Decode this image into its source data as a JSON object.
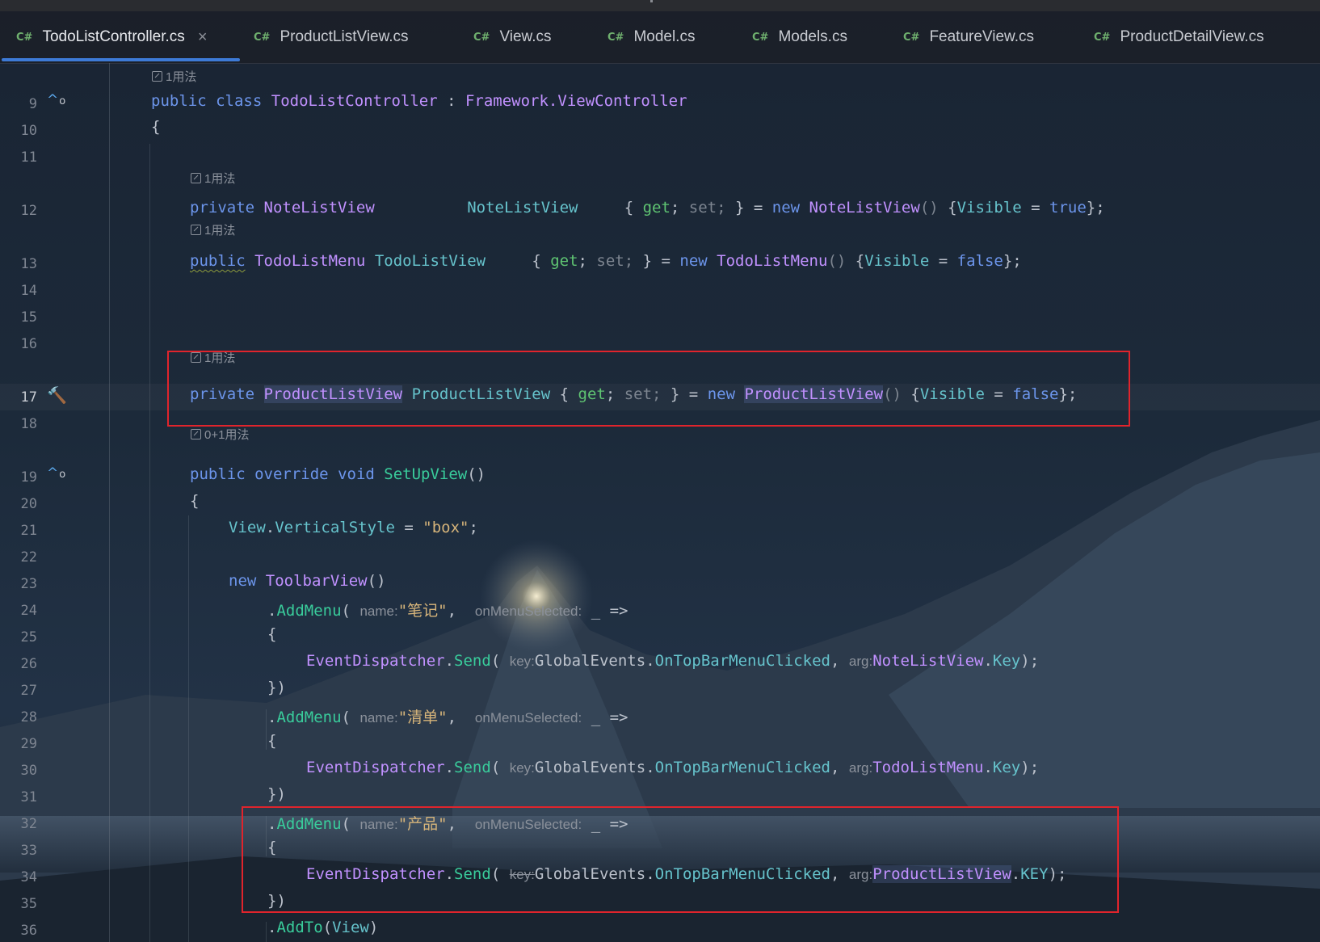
{
  "tabs": [
    {
      "icon": "C#",
      "label": "TodoListController.cs",
      "active": true,
      "close": "×"
    },
    {
      "icon": "C#",
      "label": "ProductListView.cs"
    },
    {
      "icon": "C#",
      "label": "View.cs"
    },
    {
      "icon": "C#",
      "label": "Model.cs"
    },
    {
      "icon": "C#",
      "label": "Models.cs"
    },
    {
      "icon": "C#",
      "label": "FeatureView.cs"
    },
    {
      "icon": "C#",
      "label": "ProductDetailView.cs"
    }
  ],
  "hints": {
    "usage1": "1用法",
    "usage01": "0+1用法"
  },
  "line_numbers": [
    "9",
    "10",
    "11",
    "12",
    "13",
    "14",
    "15",
    "16",
    "17",
    "18",
    "19",
    "20",
    "21",
    "22",
    "23",
    "24",
    "25",
    "26",
    "27",
    "28",
    "29",
    "30",
    "31",
    "32",
    "33",
    "34",
    "35",
    "36"
  ],
  "code": {
    "l9": {
      "kw1": "public",
      "kw2": "class",
      "name": "TodoListController",
      "colon": " : ",
      "base": "Framework.ViewController"
    },
    "l10": "{",
    "l12": {
      "mod": "private",
      "type": "NoteListView",
      "name": "NoteListView",
      "ob": "{ ",
      "get": "get",
      "semi1": ";",
      "set": " set;",
      "cb": " } = ",
      "new": "new",
      "ctor": "NoteListView",
      "paren": "()",
      "init_open": " {",
      "prop": "Visible",
      "eq": " = ",
      "val": "true",
      "end": "};"
    },
    "l13": {
      "mod": "public",
      "type": "TodoListMenu",
      "name": "TodoListView",
      "ob": "{ ",
      "get": "get",
      "semi1": ";",
      "set": " set;",
      "cb": " } = ",
      "new": "new",
      "ctor": "TodoListMenu",
      "paren": "()",
      "init_open": " {",
      "prop": "Visible",
      "eq": " = ",
      "val": "false",
      "end": "};"
    },
    "l17": {
      "mod": "private",
      "type": "ProductListView",
      "name": "ProductListView",
      "ob": " { ",
      "get": "get",
      "semi1": ";",
      "set": " set;",
      "cb": " } = ",
      "new": "new",
      "ctor": "ProductListView",
      "paren": "()",
      "init_open": " {",
      "prop": "Visible",
      "eq": " = ",
      "val": "false",
      "end": "};"
    },
    "l19": {
      "kw1": "public",
      "kw2": "override",
      "kw3": "void",
      "name": "SetUpView",
      "paren": "()"
    },
    "l20": "{",
    "l21": {
      "obj": "View",
      "dot": ".",
      "prop": "VerticalStyle",
      "eq": " = ",
      "str": "\"box\"",
      "end": ";"
    },
    "l23": {
      "new": "new",
      "ctor": "ToolbarView",
      "paren": "()"
    },
    "l24": {
      "dot": ".",
      "method": "AddMenu",
      "open": "(",
      "name_lbl": "name:",
      "str": "\"笔记\"",
      "comma": ",",
      "sel_lbl": "onMenuSelected:",
      "lambda": " _ =>"
    },
    "l25": "{",
    "l26": {
      "cls": "EventDispatcher",
      "dot": ".",
      "method": "Send",
      "open": "(",
      "key_lbl": "key:",
      "ev": "GlobalEvents",
      "dot2": ".",
      "evm": "OnTopBarMenuClicked",
      "comma": ",",
      "arg_lbl": "arg:",
      "target": "NoteListView",
      "dot3": ".",
      "keyprop": "Key",
      "end": ");"
    },
    "l27": "})",
    "l28": {
      "dot": ".",
      "method": "AddMenu",
      "open": "(",
      "name_lbl": "name:",
      "str": "\"清单\"",
      "comma": ",",
      "sel_lbl": "onMenuSelected:",
      "lambda": " _ =>"
    },
    "l29": "{",
    "l30": {
      "cls": "EventDispatcher",
      "dot": ".",
      "method": "Send",
      "open": "(",
      "key_lbl": "key:",
      "ev": "GlobalEvents",
      "dot2": ".",
      "evm": "OnTopBarMenuClicked",
      "comma": ",",
      "arg_lbl": "arg:",
      "target": "TodoListMenu",
      "dot3": ".",
      "keyprop": "Key",
      "end": ");"
    },
    "l31": "})",
    "l32": {
      "dot": ".",
      "method": "AddMenu",
      "open": "(",
      "name_lbl": "name:",
      "str": "\"产品\"",
      "comma": ",",
      "sel_lbl": "onMenuSelected:",
      "lambda": " _ =>"
    },
    "l33": "{",
    "l34": {
      "cls": "EventDispatcher",
      "dot": ".",
      "method": "Send",
      "open": "(",
      "key_lbl": "key:",
      "ev": "GlobalEvents",
      "dot2": ".",
      "evm": "OnTopBarMenuClicked",
      "comma": ",",
      "arg_lbl": "arg:",
      "target": "ProductListView",
      "dot3": ".",
      "keyprop": "KEY",
      "end": ");"
    },
    "l35": "})",
    "l36": {
      "dot": ".",
      "method": "AddTo",
      "open": "(",
      "arg": "View",
      "close": ")"
    }
  },
  "colors": {
    "keyword": "#6c95eb",
    "type": "#c191ff",
    "property": "#66c3cc",
    "method": "#39cc9b",
    "string": "#d6b47a",
    "annotation_box": "#e0242c",
    "active_tab_underline": "#3d7ad6"
  }
}
